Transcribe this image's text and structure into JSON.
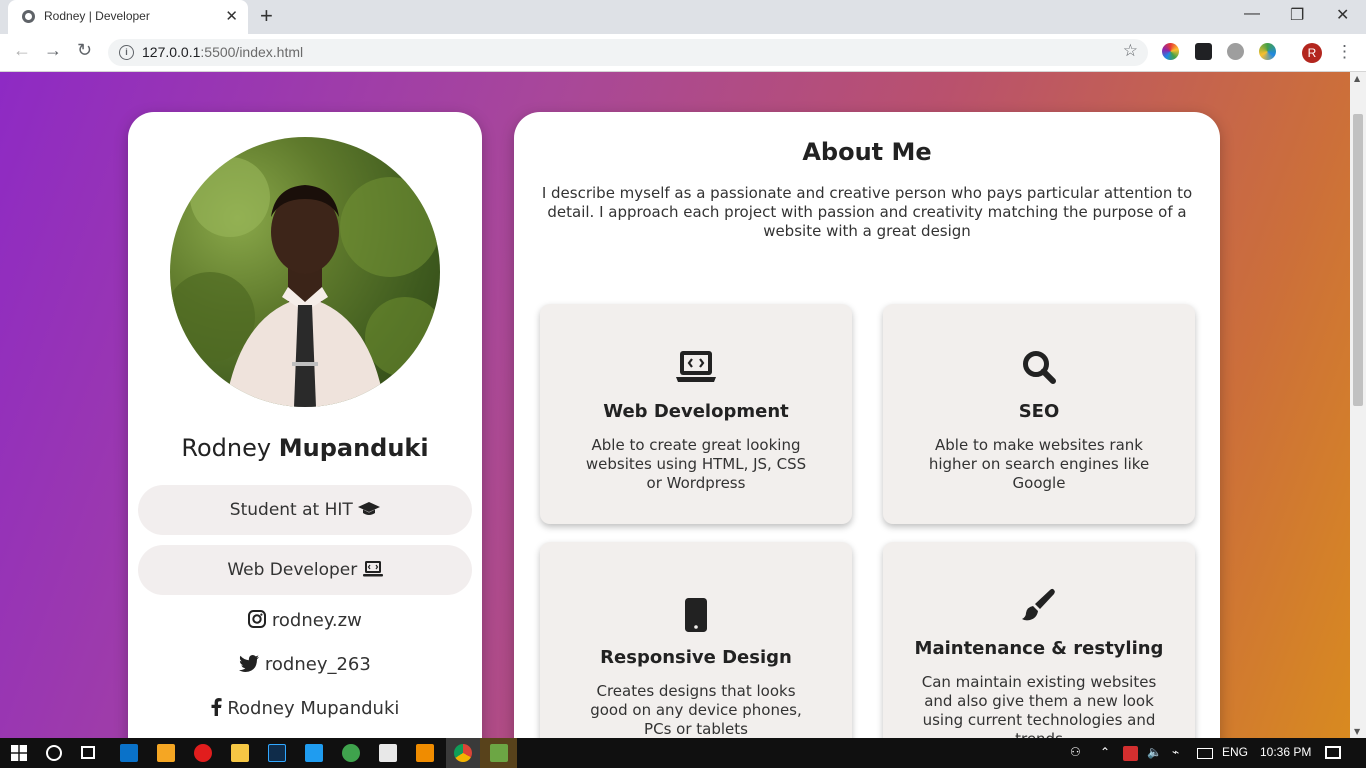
{
  "browser": {
    "tab_title": "Rodney | Developer",
    "tab_close": "✕",
    "new_tab": "+",
    "url_host": "127.0.0.1",
    "url_rest": ":5500/index.html",
    "profile_initial": "R",
    "window_controls": {
      "minimize": "—",
      "restore": "❐",
      "close": "✕"
    }
  },
  "profile": {
    "first_name": "Rodney",
    "last_name": "Mupanduki",
    "pills": [
      {
        "label": "Student at HIT",
        "icon": "graduation-cap-icon"
      },
      {
        "label": "Web Developer",
        "icon": "laptop-code-icon"
      }
    ],
    "socials": [
      {
        "label": "rodney.zw",
        "icon": "instagram-icon"
      },
      {
        "label": "rodney_263",
        "icon": "twitter-icon"
      },
      {
        "label": "Rodney Mupanduki",
        "icon": "facebook-icon"
      }
    ]
  },
  "about": {
    "title": "About Me",
    "text": "I describe myself as a passionate and creative person who pays particular attention to detail. I approach each project with passion and creativity matching the purpose of a website with a great design"
  },
  "services": [
    {
      "title": "Web Development",
      "icon": "laptop-code-icon",
      "desc": "Able to create great looking websites using HTML, JS, CSS or Wordpress"
    },
    {
      "title": "SEO",
      "icon": "search-icon",
      "desc": "Able to make websites rank higher on search engines like Google"
    },
    {
      "title": "Responsive Design",
      "icon": "mobile-icon",
      "desc": "Creates designs that looks good on any device phones, PCs or tablets"
    },
    {
      "title": "Maintenance & restyling",
      "icon": "paint-brush-icon",
      "desc": "Can maintain existing websites and also give them a new look using current technologies and trends"
    }
  ],
  "taskbar": {
    "language": "ENG",
    "time": "10:36 PM"
  },
  "colors": {
    "gradient_start": "#8e2ac4",
    "gradient_end": "#d88a20",
    "card_bg": "#ffffff",
    "service_bg": "#f2efed"
  }
}
